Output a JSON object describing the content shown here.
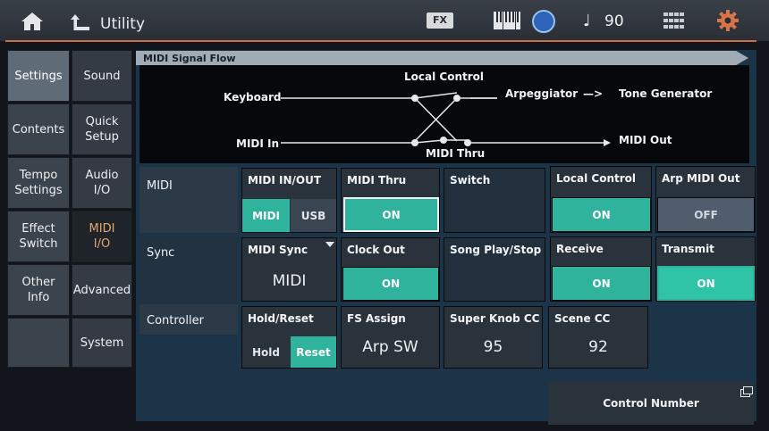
{
  "header": {
    "title": "Utility",
    "fx_label": "FX",
    "tempo_symbol": "♩",
    "tempo": "90",
    "icons": [
      "home-icon",
      "back-icon",
      "keyboard-icon",
      "dial-icon",
      "grid-icon",
      "gear-icon"
    ]
  },
  "tabs_left": [
    {
      "label": "Settings",
      "active": true
    },
    {
      "label": "Contents",
      "active": false
    },
    {
      "label": "Tempo Settings",
      "active": false
    },
    {
      "label": "Effect Switch",
      "active": false
    },
    {
      "label": "Other Info",
      "active": false
    }
  ],
  "tabs_right": [
    {
      "label": "Sound",
      "active": false
    },
    {
      "label": "Quick Setup",
      "active": false
    },
    {
      "label": "Audio I/O",
      "active": false
    },
    {
      "label": "MIDI I/O",
      "active": true
    },
    {
      "label": "Advanced",
      "active": false
    },
    {
      "label": "System",
      "active": false
    }
  ],
  "flow": {
    "section_title": "MIDI Signal Flow",
    "keyboard": "Keyboard",
    "midi_in": "MIDI In",
    "local_control": "Local Control",
    "midi_thru": "MIDI Thru",
    "arpeggiator": "Arpeggiator",
    "arrow1": "—>",
    "tone_generator": "Tone Generator",
    "arrow2": "—>",
    "midi_out": "MIDI Out"
  },
  "rows": {
    "midi": "MIDI",
    "sync": "Sync",
    "controller": "Controller"
  },
  "params": {
    "midi_inout": {
      "label": "MIDI IN/OUT",
      "options": [
        "MIDI",
        "USB"
      ],
      "selected": "MIDI"
    },
    "midi_thru": {
      "label": "MIDI Thru",
      "value": "ON"
    },
    "switch": {
      "label": "Switch"
    },
    "local_control": {
      "label": "Local Control",
      "value": "ON"
    },
    "arp_midi_out": {
      "label": "Arp MIDI Out",
      "value": "OFF"
    },
    "midi_sync": {
      "label": "MIDI Sync",
      "value": "MIDI"
    },
    "clock_out": {
      "label": "Clock Out",
      "value": "ON"
    },
    "song_play_stop": {
      "label": "Song Play/Stop"
    },
    "receive": {
      "label": "Receive",
      "value": "ON"
    },
    "transmit": {
      "label": "Transmit",
      "value": "ON"
    },
    "hold_reset": {
      "label": "Hold/Reset",
      "options": [
        "Hold",
        "Reset"
      ],
      "selected": "Reset"
    },
    "fs_assign": {
      "label": "FS Assign",
      "value": "Arp SW"
    },
    "super_knob_cc": {
      "label": "Super Knob CC",
      "value": "95"
    },
    "scene_cc": {
      "label": "Scene CC",
      "value": "92"
    },
    "control_number": {
      "label": "Control Number"
    }
  },
  "colors": {
    "accent_on": "#2fb39c",
    "header_rule": "#c9703f",
    "active_tab_text": "#e7a56f"
  }
}
